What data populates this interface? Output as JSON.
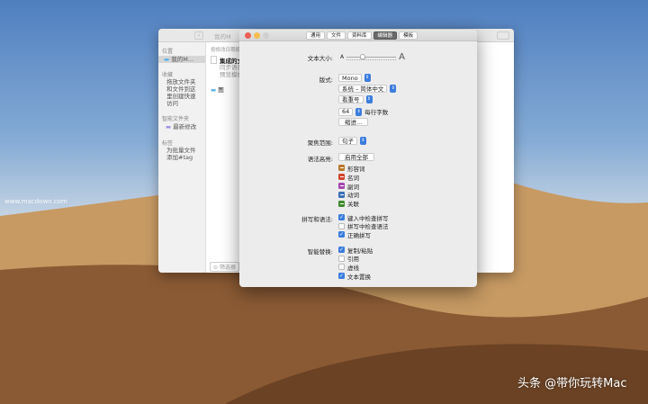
{
  "finder": {
    "location_header": "位置",
    "location_item": "我的M...",
    "title": "我的M",
    "favorites_header": "收藏",
    "favorites_hint": [
      "拖放文件夹",
      "和文件到这",
      "里创建快速",
      "访问"
    ],
    "smart_header": "智能文件夹",
    "smart_item": "最新修改",
    "tags_header": "标签",
    "tags_hint": [
      "为批量文件",
      "添加#tag"
    ],
    "sort_label": "按修改日期顺",
    "doc_title": "集成的文",
    "doc_lines": [
      "同步语在",
      "预览模板"
    ],
    "folder_item": "图",
    "filter_placeholder": "筛选器"
  },
  "prefs": {
    "tabs": [
      {
        "label": "通用",
        "active": false
      },
      {
        "label": "文件",
        "active": false
      },
      {
        "label": "资料库",
        "active": false
      },
      {
        "label": "编辑器",
        "active": true
      },
      {
        "label": "模板",
        "active": false
      }
    ],
    "text_size_label": "文本大小:",
    "text_size_small": "A",
    "text_size_large": "A",
    "text_size_value": 0.3,
    "font_label": "版式:",
    "font_value": "Mono",
    "language_value": "系统 – 简体中文",
    "quote_value": "看重号",
    "chars_value": "64",
    "chars_label": "每行字数",
    "indent_button": "缩进...",
    "focus_label": "聚焦范围:",
    "focus_value": "句子",
    "syntax_label": "语法高亮:",
    "enable_all_button": "启用全部",
    "syntax_items": [
      {
        "label": "形容词",
        "color": "#b8782c"
      },
      {
        "label": "名词",
        "color": "#d0442c"
      },
      {
        "label": "副词",
        "color": "#a646b0"
      },
      {
        "label": "动词",
        "color": "#3a6fb5"
      },
      {
        "label": "关联",
        "color": "#3f8a2e"
      }
    ],
    "spell_label": "拼写和语法:",
    "spell_items": [
      {
        "label": "键入中检查拼写",
        "checked": true
      },
      {
        "label": "拼写中检查语法",
        "checked": false
      },
      {
        "label": "正确拼写",
        "checked": true
      }
    ],
    "smart_label": "智能替换:",
    "smart_items": [
      {
        "label": "复制/粘贴",
        "checked": true
      },
      {
        "label": "引用",
        "checked": false
      },
      {
        "label": "虚线",
        "checked": false
      },
      {
        "label": "文本置换",
        "checked": true
      }
    ]
  },
  "watermarks": {
    "left": "www.macdown.com",
    "right": "头条 @带你玩转Mac"
  }
}
